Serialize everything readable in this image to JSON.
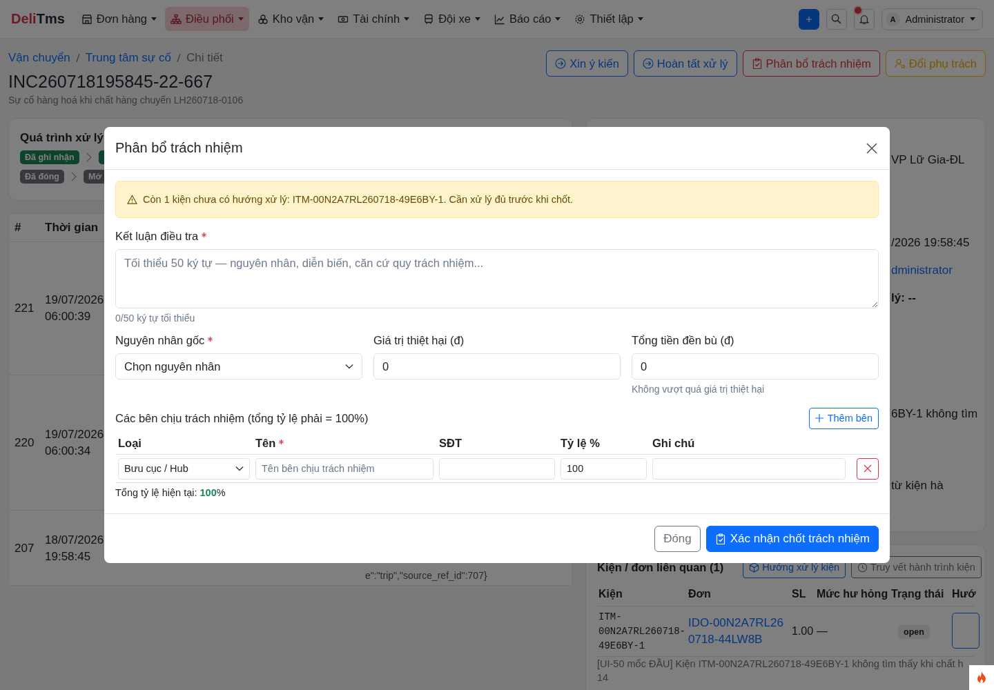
{
  "navbar": {
    "logo": [
      "Deli",
      "Tms"
    ],
    "menu": [
      {
        "label": "Đơn hàng",
        "selected": false
      },
      {
        "label": "Điều phối",
        "selected": true
      },
      {
        "label": "Kho vận",
        "selected": false
      },
      {
        "label": "Tài chính",
        "selected": false
      },
      {
        "label": "Đội xe",
        "selected": false
      },
      {
        "label": "Báo cáo",
        "selected": false
      },
      {
        "label": "Thiết lập",
        "selected": false
      }
    ],
    "has_notification": true,
    "user": {
      "avatar": "A",
      "name": "Administrator"
    }
  },
  "breadcrumb": {
    "links": [
      "Vận chuyển",
      "Trung tâm sự cố"
    ],
    "current": "Chi tiết"
  },
  "title": "INC260718195845-22-667",
  "subtitle": "Sự cố hàng hoá khi chất hàng chuyến LH260718-0106",
  "actions": [
    {
      "label": "Xin ý kiến",
      "kind": "primary"
    },
    {
      "label": "Hoàn tất xử lý",
      "kind": "primary"
    },
    {
      "label": "Phân bổ trách nhiệm",
      "kind": "danger"
    },
    {
      "label": "Đổi phụ trách",
      "kind": "warning"
    }
  ],
  "process": {
    "title": "Quá trình xử lý",
    "rows": [
      [
        {
          "label": "Đã ghi nhận",
          "kind": "done"
        },
        {
          "kind": "done"
        }
      ],
      [
        {
          "label": "Đã đóng",
          "kind": "closed"
        },
        {
          "label": "Mở",
          "kind": "closed"
        }
      ]
    ]
  },
  "history": {
    "columns": [
      "#",
      "Thời gian"
    ],
    "rows": [
      {
        "no": "221",
        "date": "19/07/2026",
        "time": "06:00:39"
      },
      {
        "no": "220",
        "date": "19/07/2026",
        "time": "06:00:34"
      },
      {
        "no": "207",
        "date": "18/07/2026",
        "time": "19:58:45"
      }
    ],
    "payload_tail": "e\":\"trip\",\"source_ref_id\":707}"
  },
  "detail_fragments": [
    {
      "text": "VP Lữ Gia-ĐL",
      "kind": "text"
    },
    {
      "text": "/2026 19:58:45",
      "kind": "text"
    },
    {
      "text": "dministrator",
      "kind": "link"
    },
    {
      "text": "lý: --",
      "kind": "strong"
    },
    {
      "text": "6BY-1 không tìm",
      "kind": "text"
    },
    {
      "text": "từ kiện hà",
      "kind": "text"
    }
  ],
  "related": {
    "title": "Kiện / đơn liên quan (1)",
    "buttons": [
      {
        "label": "Hướng xử lý kiện",
        "kind": "primary"
      },
      {
        "label": "Truy vết hành trình kiện",
        "kind": "secondary"
      }
    ],
    "columns": [
      "Kiện",
      "Đơn",
      "SL",
      "Mức hư hỏng",
      "Trạng thái",
      "Hướ"
    ],
    "rows": [
      {
        "item": "ITM-00N2A7RL260718-49E6BY-1",
        "order": "IDO-00N2A7RL260718-44LW8B",
        "qty": "1.00",
        "damage": "—",
        "status": "open"
      }
    ],
    "note": "[UI-50 mốc ĐẦU] Kiện ITM-00N2A7RL260718-49E6BY-1 không tìm thấy khi chất h",
    "note_tail": "14"
  },
  "modal": {
    "title": "Phân bổ trách nhiệm",
    "alert": "Còn 1 kiện chưa có hướng xử lý: ITM-00N2A7RL260718-49E6BY-1. Cần xử lý đủ trước khi chốt.",
    "conclusion": {
      "label": "Kết luận điều tra",
      "required": true,
      "placeholder": "Tối thiểu 50 ký tự — nguyên nhân, diễn biến, căn cứ quy trách nhiệm...",
      "help": "0/50 ký tự tối thiểu"
    },
    "fields": [
      {
        "label": "Nguyên nhân gốc",
        "required": true,
        "kind": "select",
        "value": "Chọn nguyên nhân"
      },
      {
        "label": "Giá trị thiệt hại (đ)",
        "required": false,
        "kind": "input",
        "value": "0"
      },
      {
        "label": "Tổng tiền đền bù (đ)",
        "required": false,
        "kind": "input",
        "value": "0",
        "help": "Không vượt quá giá trị thiệt hại"
      }
    ],
    "parties": {
      "title": "Các bên chịu trách nhiệm (tổng tỷ lệ phải = 100%)",
      "add_button": "Thêm bên",
      "columns": [
        {
          "label": "Loại",
          "required": false
        },
        {
          "label": "Tên",
          "required": true
        },
        {
          "label": "SĐT",
          "required": false
        },
        {
          "label": "Tỷ lệ %",
          "required": false
        },
        {
          "label": "Ghi chú",
          "required": false
        }
      ],
      "rows": [
        {
          "type": "Bưu cục / Hub",
          "name_placeholder": "Tên bên chịu trách nhiệm",
          "ratio": "100"
        }
      ],
      "total": "Tổng tỷ lệ hiện tại: **100**%"
    },
    "buttons": [
      {
        "label": "Đóng",
        "kind": "secondary"
      },
      {
        "label": "Xác nhận chốt trách nhiệm",
        "kind": "primary"
      }
    ]
  }
}
